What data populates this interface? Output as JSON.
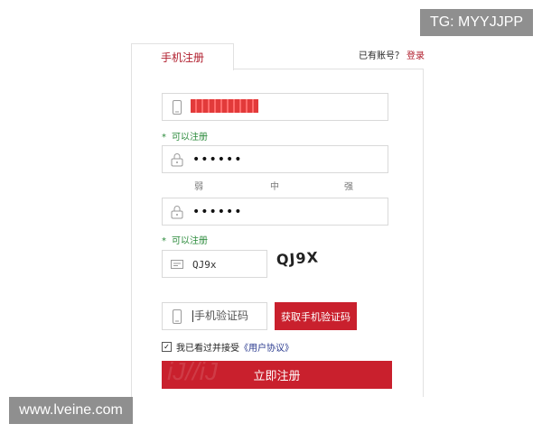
{
  "watermarks": {
    "top": "TG: MYYJJPP",
    "bottom": "www.lveine.com"
  },
  "tab": {
    "label": "手机注册"
  },
  "login_prompt": {
    "text": "已有账号？",
    "link": "登录"
  },
  "phone_field": {
    "icon": "phone-icon",
    "value_redacted": true
  },
  "hints": {
    "phone_ok": "可以注册",
    "confirm_ok": "可以注册",
    "star": "*"
  },
  "password": {
    "icon": "lock-icon",
    "value": "••••••"
  },
  "strength": {
    "weak": "弱",
    "medium": "中",
    "strong": "强"
  },
  "confirm_password": {
    "icon": "lock-icon",
    "value": "••••••"
  },
  "captcha": {
    "icon": "captcha-icon",
    "value": "QJ9x",
    "image_text": "QJ9X"
  },
  "sms": {
    "icon": "phone-icon",
    "placeholder": "手机验证码",
    "button": "获取手机验证码"
  },
  "agreement": {
    "checked": true,
    "check_mark": "✓",
    "text": "我已看过并接受",
    "link": "《用户协议》"
  },
  "submit": {
    "label": "立即注册",
    "ghost": "iJ//iJ"
  },
  "colors": {
    "accent": "#c9202d",
    "hint_green": "#2a8a3a",
    "link_blue": "#2a3a8f"
  }
}
